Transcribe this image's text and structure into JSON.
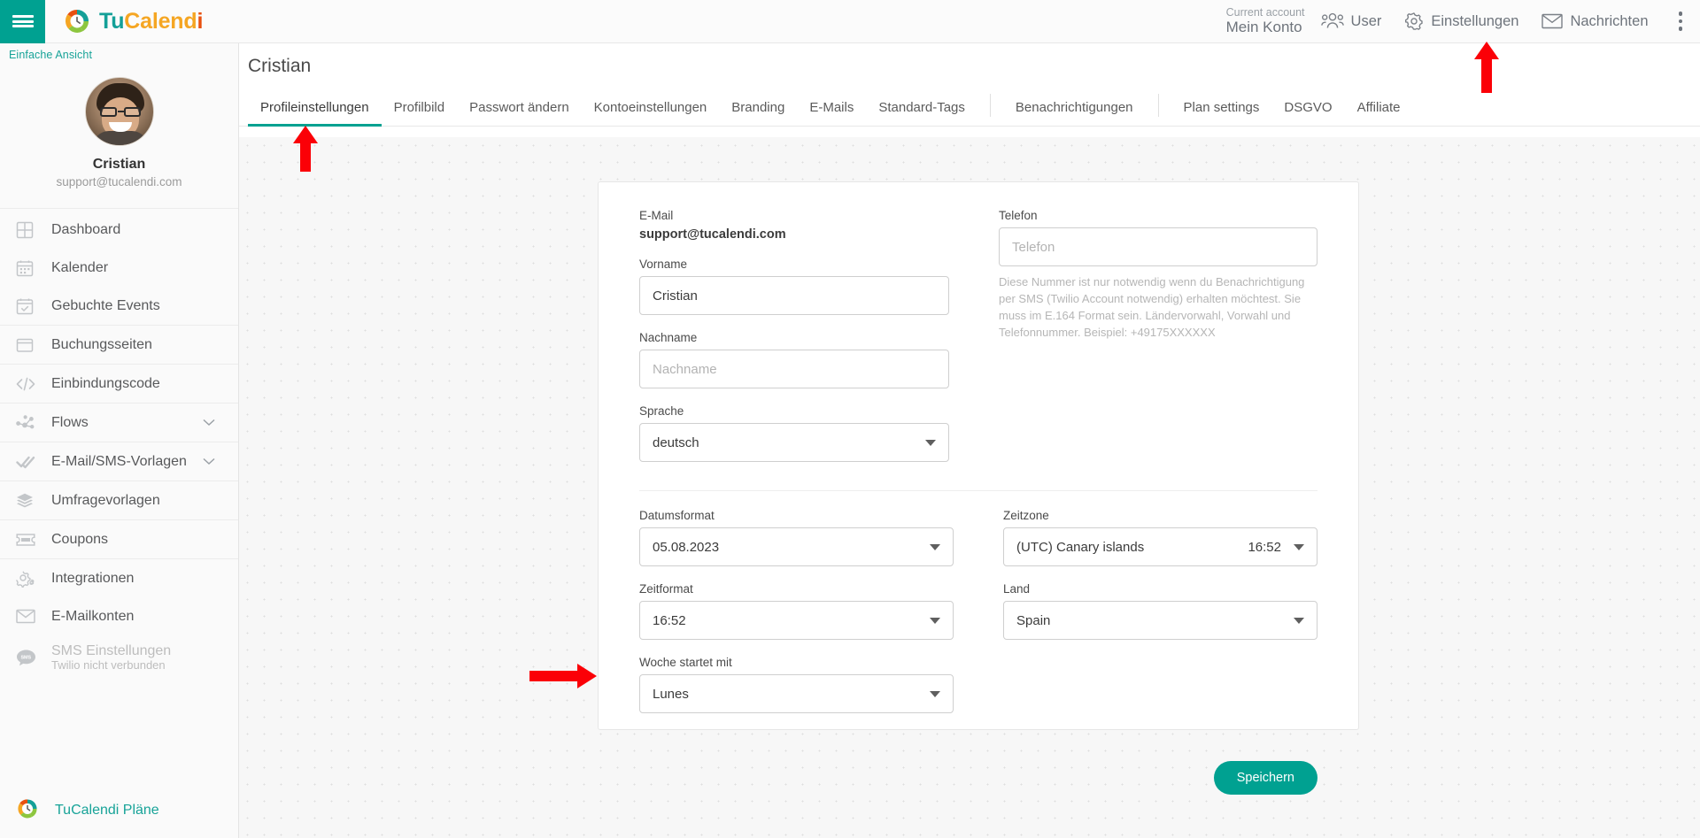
{
  "brand": {
    "part1": "Tu",
    "part2": "Calend",
    "part3": "i",
    "logo_icon": "tucalendi-logo-icon"
  },
  "topbar": {
    "menu_icon": "hamburger-menu-icon",
    "account_caption": "Current account",
    "account_name": "Mein Konto",
    "items": [
      {
        "label": "User",
        "icon": "users-icon"
      },
      {
        "label": "Einstellungen",
        "icon": "gear-icon"
      },
      {
        "label": "Nachrichten",
        "icon": "envelope-icon"
      }
    ],
    "overflow_icon": "kebab-menu-icon"
  },
  "sidebar": {
    "simple_view": "Einfache Ansicht",
    "profile": {
      "name": "Cristian",
      "email": "support@tucalendi.com",
      "avatar": "user-avatar"
    },
    "items": [
      {
        "label": "Dashboard",
        "icon": "grid-icon",
        "sub": "",
        "chevron": false,
        "dim": false,
        "sep_after": false
      },
      {
        "label": "Kalender",
        "icon": "calendar-icon",
        "sub": "",
        "chevron": false,
        "dim": false,
        "sep_after": false
      },
      {
        "label": "Gebuchte Events",
        "icon": "calendar-check-icon",
        "sub": "",
        "chevron": false,
        "dim": false,
        "sep_after": true
      },
      {
        "label": "Buchungsseiten",
        "icon": "window-icon",
        "sub": "",
        "chevron": false,
        "dim": false,
        "sep_after": true
      },
      {
        "label": "Einbindungscode",
        "icon": "code-icon",
        "sub": "",
        "chevron": false,
        "dim": false,
        "sep_after": true
      },
      {
        "label": "Flows",
        "icon": "flow-nodes-icon",
        "sub": "",
        "chevron": true,
        "dim": false,
        "sep_after": true
      },
      {
        "label": "E-Mail/SMS-Vorlagen",
        "icon": "double-check-icon",
        "sub": "",
        "chevron": true,
        "dim": false,
        "sep_after": true
      },
      {
        "label": "Umfragevorlagen",
        "icon": "layers-icon",
        "sub": "",
        "chevron": false,
        "dim": false,
        "sep_after": true
      },
      {
        "label": "Coupons",
        "icon": "ticket-icon",
        "sub": "",
        "chevron": false,
        "dim": false,
        "sep_after": true
      },
      {
        "label": "Integrationen",
        "icon": "gears-icon",
        "sub": "",
        "chevron": false,
        "dim": false,
        "sep_after": false
      },
      {
        "label": "E-Mailkonten",
        "icon": "envelope-icon",
        "sub": "",
        "chevron": false,
        "dim": false,
        "sep_after": false
      },
      {
        "label": "SMS Einstellungen",
        "icon": "sms-bubble-icon",
        "sub": "Twilio nicht verbunden",
        "chevron": false,
        "dim": true,
        "sep_after": false
      }
    ],
    "plans_label": "TuCalendi Pläne",
    "plans_icon": "tucalendi-logo-icon"
  },
  "main": {
    "page_title": "Cristian",
    "tabs": [
      {
        "label": "Profileinstellungen",
        "active": true
      },
      {
        "label": "Profilbild",
        "active": false
      },
      {
        "label": "Passwort ändern",
        "active": false
      },
      {
        "label": "Kontoeinstellungen",
        "active": false
      },
      {
        "label": "Branding",
        "active": false
      },
      {
        "label": "E-Mails",
        "active": false
      },
      {
        "label": "Standard-Tags",
        "active": false
      },
      {
        "label": "Benachrichtigungen",
        "active": false
      },
      {
        "label": "Plan settings",
        "active": false
      },
      {
        "label": "DSGVO",
        "active": false
      },
      {
        "label": "Affiliate",
        "active": false
      }
    ],
    "form": {
      "email": {
        "label": "E-Mail",
        "value": "support@tucalendi.com"
      },
      "vorname": {
        "label": "Vorname",
        "value": "Cristian",
        "placeholder": "Vorname"
      },
      "nachname": {
        "label": "Nachname",
        "value": "",
        "placeholder": "Nachname"
      },
      "sprache": {
        "label": "Sprache",
        "value": "deutsch"
      },
      "telefon": {
        "label": "Telefon",
        "value": "",
        "placeholder": "Telefon",
        "help": "Diese Nummer ist nur notwendig wenn du Benachrichtigung per SMS (Twilio Account notwendig) erhalten möchtest. Sie muss im E.164 Format sein. Ländervorwahl, Vorwahl und Telefonnummer. Beispiel: +49175XXXXXX"
      },
      "datumsformat": {
        "label": "Datumsformat",
        "value": "05.08.2023"
      },
      "zeitzone": {
        "label": "Zeitzone",
        "value": "(UTC) Canary islands",
        "time": "16:52"
      },
      "zeitformat": {
        "label": "Zeitformat",
        "value": "16:52"
      },
      "land": {
        "label": "Land",
        "value": "Spain"
      },
      "woche": {
        "label": "Woche startet mit",
        "value": "Lunes"
      },
      "save_label": "Speichern"
    }
  },
  "annotations": {
    "arrow_color": "#fb0007",
    "arrows": [
      {
        "name": "arrow-pointing-to-profileinstellungen-tab",
        "dir": "up"
      },
      {
        "name": "arrow-pointing-to-einstellungen-menu",
        "dir": "up"
      },
      {
        "name": "arrow-pointing-to-woche-startet-mit-select",
        "dir": "right"
      }
    ]
  },
  "colors": {
    "accent": "#00a191",
    "brand_orange": "#f5a623",
    "brand_red": "#e8500f",
    "arrow": "#fb0007"
  }
}
